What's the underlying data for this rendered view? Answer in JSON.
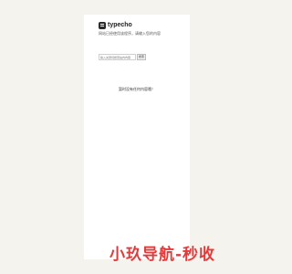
{
  "logo": {
    "text": "typecho"
  },
  "tagline": "网站已经使用该程序，请输入您的内容",
  "search": {
    "placeholder": "输入关键词搜索站内内容",
    "button_label": "搜索"
  },
  "empty_message": "暂时没有任何内容哦！",
  "watermark": "小玖导航-秒收"
}
